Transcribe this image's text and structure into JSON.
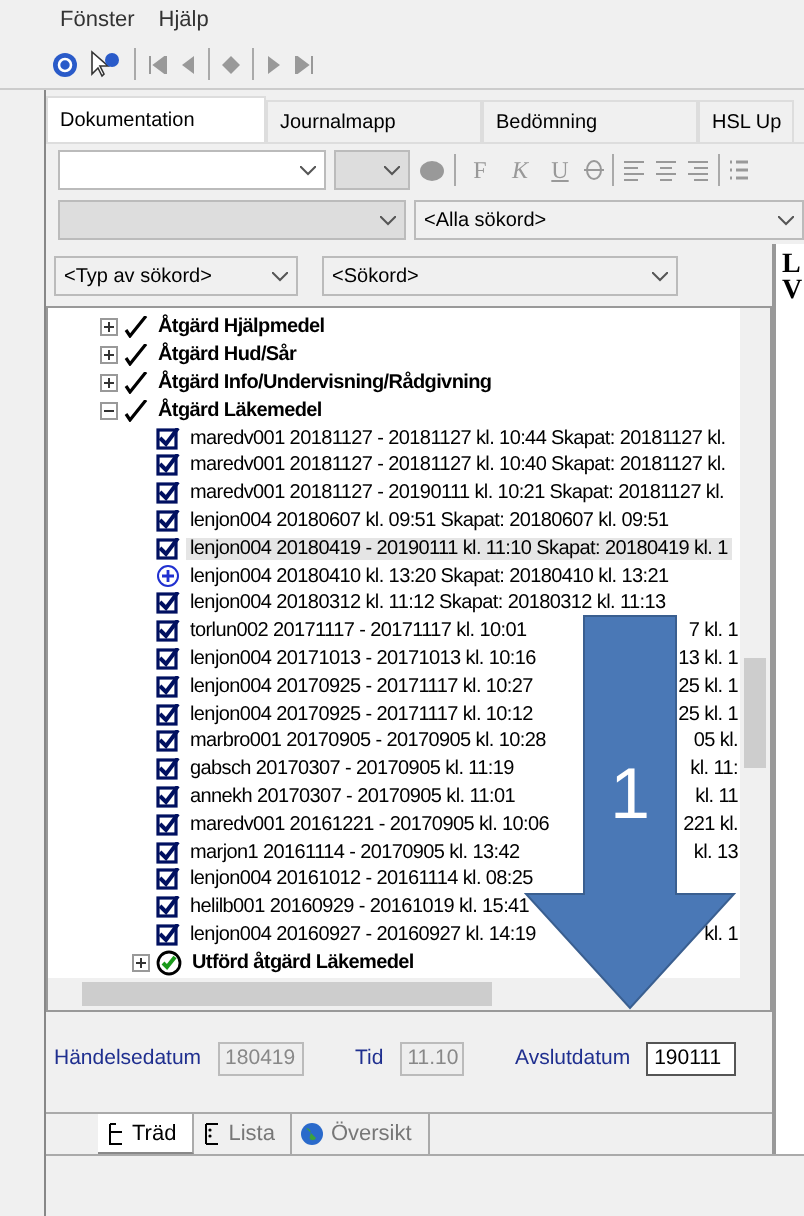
{
  "menu": [
    "Fönster",
    "Hjälp"
  ],
  "tabs": [
    {
      "label": "Dokumentation",
      "selected": true
    },
    {
      "label": "Journalmapp",
      "selected": false
    },
    {
      "label": "Bedömning",
      "selected": false
    },
    {
      "label": "HSL Up",
      "selected": false
    }
  ],
  "format_buttons": [
    "F",
    "K",
    "U"
  ],
  "filter": {
    "keyword_all": "<Alla sökord>",
    "keyword_type": "<Typ av sökord>",
    "keyword": "<Sökord>"
  },
  "tree": [
    {
      "label": "Åtgärd Hjälpmedel",
      "kind": "group",
      "expanded": false
    },
    {
      "label": "Åtgärd Hud/Sår",
      "kind": "group",
      "expanded": false
    },
    {
      "label": "Åtgärd Info/Undervisning/Rådgivning",
      "kind": "group",
      "expanded": false
    },
    {
      "label": "Åtgärd Läkemedel",
      "kind": "group",
      "expanded": true,
      "children": [
        {
          "label": "maredv001 20181127 - 20181127  kl. 10:44  Skapat: 20181127 kl.",
          "kind": "note",
          "selected": false
        },
        {
          "label": "maredv001 20181127 - 20181127  kl. 10:40  Skapat: 20181127 kl.",
          "kind": "note",
          "selected": false
        },
        {
          "label": "maredv001 20181127 - 20190111  kl. 10:21  Skapat: 20181127 kl.",
          "kind": "note",
          "selected": false
        },
        {
          "label": "lenjon004 20180607  kl. 09:51  Skapat: 20180607 kl. 09:51",
          "kind": "note",
          "selected": false
        },
        {
          "label": "lenjon004 20180419 - 20190111  kl. 11:10  Skapat: 20180419 kl. 1",
          "kind": "note",
          "selected": true
        },
        {
          "label": "lenjon004 20180410  kl. 13:20  Skapat: 20180410 kl. 13:21",
          "kind": "added",
          "selected": false
        },
        {
          "label": "lenjon004 20180312  kl. 11:12  Skapat: 20180312 kl. 11:13",
          "kind": "note",
          "selected": false
        },
        {
          "label": "torlun002 20171117 - 20171117  kl. 10:01",
          "tail": "7 kl. 1",
          "kind": "note",
          "selected": false
        },
        {
          "label": "lenjon004 20171013 - 20171013  kl. 10:16",
          "tail": "13 kl. 1",
          "kind": "note",
          "selected": false
        },
        {
          "label": "lenjon004 20170925 - 20171117  kl. 10:27",
          "tail": "25 kl. 1",
          "kind": "note",
          "selected": false
        },
        {
          "label": "lenjon004 20170925 - 20171117  kl. 10:12",
          "tail": "25 kl. 1",
          "kind": "note",
          "selected": false
        },
        {
          "label": "marbro001 20170905 - 20170905  kl. 10:28",
          "tail": "05 kl.",
          "kind": "note",
          "selected": false
        },
        {
          "label": "gabsch 20170307 - 20170905  kl. 11:19",
          "tail": "kl. 11:",
          "kind": "note",
          "selected": false
        },
        {
          "label": "annekh 20170307 - 20170905  kl. 11:01",
          "tail": "kl. 11",
          "kind": "note",
          "selected": false
        },
        {
          "label": "maredv001 20161221 - 20170905  kl. 10:06",
          "tail": "221 kl.",
          "kind": "note",
          "selected": false
        },
        {
          "label": "marjon1 20161114 - 20170905  kl. 13:42",
          "tail": "kl. 13",
          "kind": "note",
          "selected": false
        },
        {
          "label": "lenjon004 20161012 - 20161114  kl. 08:25",
          "kind": "note",
          "selected": false
        },
        {
          "label": "helilb001 20160929 - 20161019  kl. 15:41",
          "kind": "note",
          "selected": false
        },
        {
          "label": "lenjon004 20160927 - 20160927  kl. 14:19",
          "tail": "kl. 1",
          "kind": "note",
          "selected": false
        },
        {
          "label": "Utförd åtgärd Läkemedel",
          "kind": "done",
          "expanded": false
        }
      ]
    }
  ],
  "side_text": [
    "L",
    "V"
  ],
  "fields": [
    {
      "label": "Händelsedatum",
      "value": "180419",
      "disabled": true
    },
    {
      "label": "Tid",
      "value": "11.10",
      "disabled": true
    },
    {
      "label": "Avslutdatum",
      "value": "190111",
      "disabled": false
    }
  ],
  "view_tabs": [
    {
      "label": "Träd",
      "kind": "tree",
      "selected": true
    },
    {
      "label": "Lista",
      "kind": "list",
      "selected": false
    },
    {
      "label": "Översikt",
      "kind": "globe",
      "selected": false
    }
  ],
  "annotation": {
    "number": "1"
  }
}
